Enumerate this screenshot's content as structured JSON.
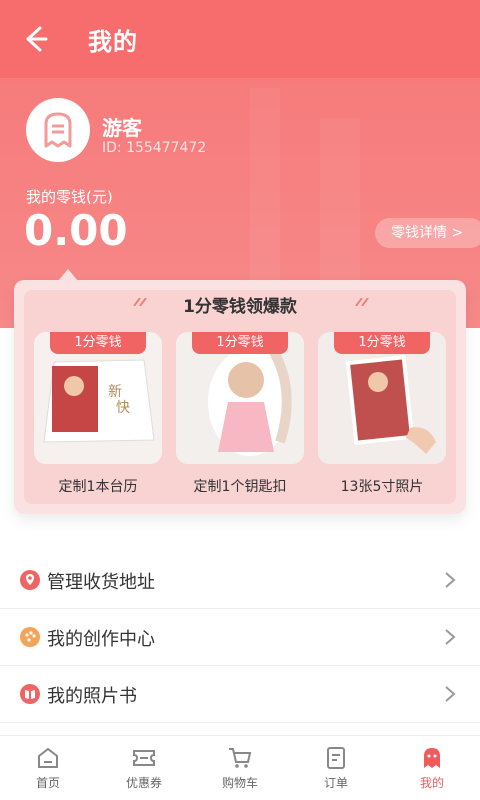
{
  "header": {
    "title": "我的"
  },
  "profile": {
    "name": "游客",
    "id_text": "ID: 155477472"
  },
  "wallet": {
    "label": "我的零钱(元)",
    "balance": "0.00",
    "detail_link": "零钱详情 >"
  },
  "promo": {
    "title": "1分零钱领爆款",
    "items": [
      {
        "tag": "1分零钱",
        "label": "定制1本台历"
      },
      {
        "tag": "1分零钱",
        "label": "定制1个钥匙扣"
      },
      {
        "tag": "1分零钱",
        "label": "13张5寸照片"
      }
    ]
  },
  "menu": [
    {
      "label": "管理收货地址",
      "icon": "location-pin-icon",
      "color": "#f06464"
    },
    {
      "label": "我的创作中心",
      "icon": "palette-icon",
      "color": "#f3a457"
    },
    {
      "label": "我的照片书",
      "icon": "book-icon",
      "color": "#f06464"
    }
  ],
  "tabs": [
    {
      "label": "首页",
      "icon": "home-icon"
    },
    {
      "label": "优惠券",
      "icon": "coupon-icon"
    },
    {
      "label": "购物车",
      "icon": "cart-icon"
    },
    {
      "label": "订单",
      "icon": "order-icon"
    },
    {
      "label": "我的",
      "icon": "ghost-icon",
      "active": true
    }
  ],
  "colors": {
    "brand": "#f76d6d",
    "tag": "#f06464",
    "active_tab": "#f05c5c"
  }
}
